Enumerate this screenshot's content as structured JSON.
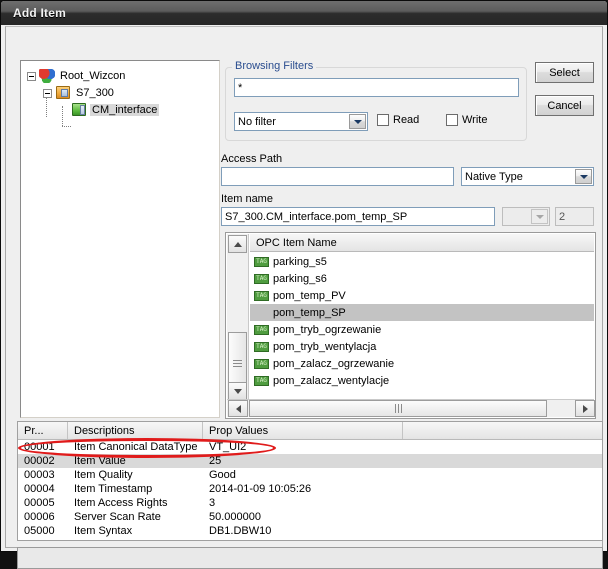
{
  "window": {
    "title": "Add Item"
  },
  "tree": {
    "nodes": [
      {
        "label": "Root_Wizcon",
        "icon": "globe-icon",
        "selected": false
      },
      {
        "label": "S7_300",
        "icon": "folder-icon",
        "selected": false
      },
      {
        "label": "CM_interface",
        "icon": "leaf-node-icon",
        "selected": true
      }
    ]
  },
  "browsing_filters": {
    "legend": "Browsing Filters",
    "filter_text_value": "*",
    "filter_text_placeholder": "",
    "filter_select_value": "No filter",
    "filter_select_options": [
      "No filter"
    ],
    "read_label": "Read",
    "read_checked": false,
    "write_label": "Write",
    "write_checked": false
  },
  "buttons": {
    "select_label": "Select",
    "cancel_label": "Cancel"
  },
  "access_path": {
    "label": "Access Path",
    "value": "",
    "placeholder": "",
    "type_value": "Native Type",
    "type_options": [
      "Native Type"
    ]
  },
  "item_name": {
    "label": "Item name",
    "value": "S7_300.CM_interface.pom_temp_SP",
    "placeholder": "",
    "aux_combo_value": "",
    "count_value": "2"
  },
  "opc_list": {
    "header": "OPC Item Name",
    "rows": [
      {
        "label": "parking_s5",
        "icon": "tag-icon",
        "selected": false
      },
      {
        "label": "parking_s6",
        "icon": "tag-icon",
        "selected": false
      },
      {
        "label": "pom_temp_PV",
        "icon": "tag-icon",
        "selected": false
      },
      {
        "label": "pom_temp_SP",
        "icon": "tag-icon",
        "selected": true
      },
      {
        "label": "pom_tryb_ogrzewanie",
        "icon": "tag-icon",
        "selected": false
      },
      {
        "label": "pom_tryb_wentylacja",
        "icon": "tag-icon",
        "selected": false
      },
      {
        "label": "pom_zalacz_ogrzewanie",
        "icon": "tag-icon",
        "selected": false
      },
      {
        "label": "pom_zalacz_wentylacje",
        "icon": "tag-icon",
        "selected": false
      }
    ]
  },
  "properties_table": {
    "columns": [
      "Pr...",
      "Descriptions",
      "Prop Values"
    ],
    "rows": [
      {
        "id": "00001",
        "description": "Item Canonical DataType",
        "value": "VT_UI2",
        "selected": false,
        "annotated": true
      },
      {
        "id": "00002",
        "description": "Item Value",
        "value": "25",
        "selected": true,
        "annotated": false
      },
      {
        "id": "00003",
        "description": "Item Quality",
        "value": "Good",
        "selected": false,
        "annotated": false
      },
      {
        "id": "00004",
        "description": "Item Timestamp",
        "value": "2014-01-09 10:05:26",
        "selected": false,
        "annotated": false
      },
      {
        "id": "00005",
        "description": "Item Access Rights",
        "value": "3",
        "selected": false,
        "annotated": false
      },
      {
        "id": "00006",
        "description": "Server Scan Rate",
        "value": "50.000000",
        "selected": false,
        "annotated": false
      },
      {
        "id": "05000",
        "description": "Item Syntax",
        "value": "DB1.DBW10",
        "selected": false,
        "annotated": false
      }
    ]
  },
  "status_bar": {
    "text": ""
  },
  "colors": {
    "group_legend": "#2a4d8f",
    "annotation": "#e01b1b",
    "selection": "#c3c3c3",
    "row_selection": "#d9d9d9",
    "titlebar": "#5c5c5c"
  }
}
